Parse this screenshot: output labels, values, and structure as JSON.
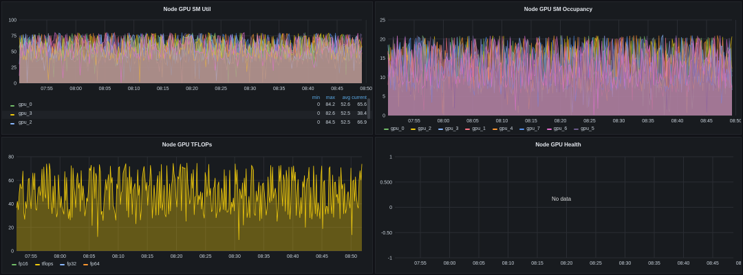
{
  "colors": {
    "gpu_0": "#73bf69",
    "gpu_1": "#ff7383",
    "gpu_2": "#f2cc0c",
    "gpu_3": "#8ab8ff",
    "gpu_4": "#ff9830",
    "gpu_5": "#6d5b8e",
    "gpu_6": "#e66fd1",
    "gpu_7": "#5794f2",
    "fp16": "#73bf69",
    "tflops": "#f2cc0c",
    "fp32": "#8ab8ff",
    "fp64": "#ff9830"
  },
  "time_ticks": [
    "07:55",
    "08:00",
    "08:05",
    "08:10",
    "08:15",
    "08:20",
    "08:25",
    "08:30",
    "08:35",
    "08:40",
    "08:45",
    "08:50"
  ],
  "panels": {
    "sm_util": {
      "title": "Node GPU SM Util",
      "y_ticks": [
        "100",
        "75",
        "50",
        "25",
        "0"
      ],
      "legend_headers": {
        "min": "min",
        "max": "max",
        "avg": "avg",
        "current": "current"
      },
      "legend": [
        {
          "name": "gpu_0",
          "color": "#73bf69",
          "min": "0",
          "max": "84.2",
          "avg": "52.6",
          "current": "65.6"
        },
        {
          "name": "gpu_3",
          "color": "#f2cc0c",
          "min": "0",
          "max": "82.6",
          "avg": "52.5",
          "current": "38.4"
        },
        {
          "name": "gpu_2",
          "color": "#8ab8ff",
          "min": "0",
          "max": "84.5",
          "avg": "52.5",
          "current": "66.9"
        }
      ]
    },
    "sm_occ": {
      "title": "Node GPU SM Occupancy",
      "y_ticks": [
        "25",
        "20",
        "15",
        "10",
        "5",
        "0"
      ],
      "legend": [
        {
          "name": "gpu_0",
          "color": "#73bf69"
        },
        {
          "name": "gpu_2",
          "color": "#f2cc0c"
        },
        {
          "name": "gpu_3",
          "color": "#8ab8ff"
        },
        {
          "name": "gpu_1",
          "color": "#ff7383"
        },
        {
          "name": "gpu_4",
          "color": "#ff9830"
        },
        {
          "name": "gpu_7",
          "color": "#5794f2"
        },
        {
          "name": "gpu_6",
          "color": "#e66fd1"
        },
        {
          "name": "gpu_5",
          "color": "#6d5b8e"
        }
      ]
    },
    "tflops": {
      "title": "Node GPU TFLOPs",
      "y_ticks": [
        "80",
        "60",
        "40",
        "20",
        "0"
      ],
      "legend": [
        {
          "name": "fp16",
          "color": "#73bf69"
        },
        {
          "name": "tflops",
          "color": "#f2cc0c"
        },
        {
          "name": "fp32",
          "color": "#8ab8ff"
        },
        {
          "name": "fp64",
          "color": "#ff9830"
        }
      ]
    },
    "health": {
      "title": "Node GPU Health",
      "y_ticks": [
        "1",
        "0.500",
        "0",
        "-0.50",
        "-1"
      ],
      "no_data": "No data"
    }
  },
  "chart_data": [
    {
      "type": "line",
      "title": "Node GPU SM Util",
      "ylim": [
        0,
        100
      ],
      "x_range": [
        "07:52",
        "08:52"
      ],
      "series": [
        {
          "name": "gpu_0",
          "band": [
            30,
            80
          ]
        },
        {
          "name": "gpu_3",
          "band": [
            30,
            80
          ]
        },
        {
          "name": "gpu_2",
          "band": [
            30,
            80
          ]
        }
      ]
    },
    {
      "type": "line",
      "title": "Node GPU SM Occupancy",
      "ylim": [
        0,
        25
      ],
      "x_range": [
        "07:52",
        "08:52"
      ],
      "series": [
        {
          "name": "gpu_0",
          "band": [
            5,
            21
          ]
        },
        {
          "name": "gpu_2",
          "band": [
            5,
            21
          ]
        },
        {
          "name": "gpu_3",
          "band": [
            5,
            21
          ]
        },
        {
          "name": "gpu_1",
          "band": [
            5,
            21
          ]
        },
        {
          "name": "gpu_4",
          "band": [
            5,
            21
          ]
        },
        {
          "name": "gpu_7",
          "band": [
            5,
            21
          ]
        },
        {
          "name": "gpu_6",
          "band": [
            5,
            21
          ]
        },
        {
          "name": "gpu_5",
          "band": [
            5,
            21
          ]
        }
      ]
    },
    {
      "type": "line",
      "title": "Node GPU TFLOPs",
      "ylim": [
        0,
        80
      ],
      "x_range": [
        "07:52",
        "08:52"
      ],
      "series": [
        {
          "name": "tflops",
          "band": [
            25,
            75
          ]
        }
      ]
    },
    {
      "type": "line",
      "title": "Node GPU Health",
      "ylim": [
        -1,
        1
      ],
      "x_range": [
        "07:52",
        "08:52"
      ],
      "series": []
    }
  ]
}
